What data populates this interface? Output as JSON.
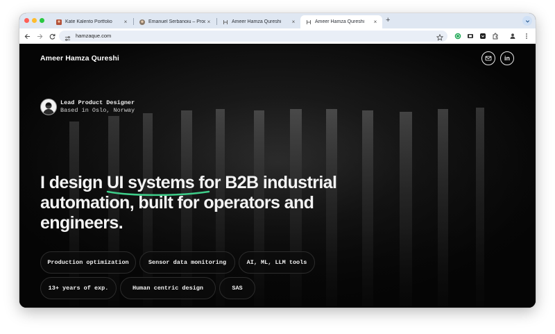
{
  "browser": {
    "tabs": [
      {
        "title": "Kate Kalento Portfolio",
        "active": false
      },
      {
        "title": "Emanuel Serbanoiu – Product…",
        "active": false
      },
      {
        "title": "Ameer Hamza Qureshi",
        "active": false
      },
      {
        "title": "Ameer Hamza Qureshi",
        "active": true
      }
    ],
    "new_tab_symbol": "+",
    "close_symbol": "×",
    "url": "hamzaque.com",
    "toolbar_icons": [
      "back-icon",
      "forward-icon",
      "reload-icon",
      "site-info-icon",
      "bookmark-star-icon",
      "extension-icon",
      "profile-icon",
      "menu-icon"
    ],
    "traffic_light_colors": [
      "#ff5f57",
      "#febc2e",
      "#28c840"
    ]
  },
  "site": {
    "brand": "Ameer Hamza Qureshi",
    "social": [
      "mail-icon",
      "linkedin-icon"
    ],
    "linkedin_label": "in",
    "profile": {
      "role": "Lead Product Designer",
      "location": "Based in Oslo, Norway"
    },
    "headline": {
      "before": "I design ",
      "highlight": "UI systems",
      "after": " for B2B industrial automation, built for operators and engineers."
    },
    "accent_color": "#3fce8a",
    "tags": [
      "Production optimization",
      "Sensor data monitoring",
      "AI, ML, LLM tools",
      "13+ years of exp.",
      "Human centric design",
      "SAS"
    ]
  }
}
